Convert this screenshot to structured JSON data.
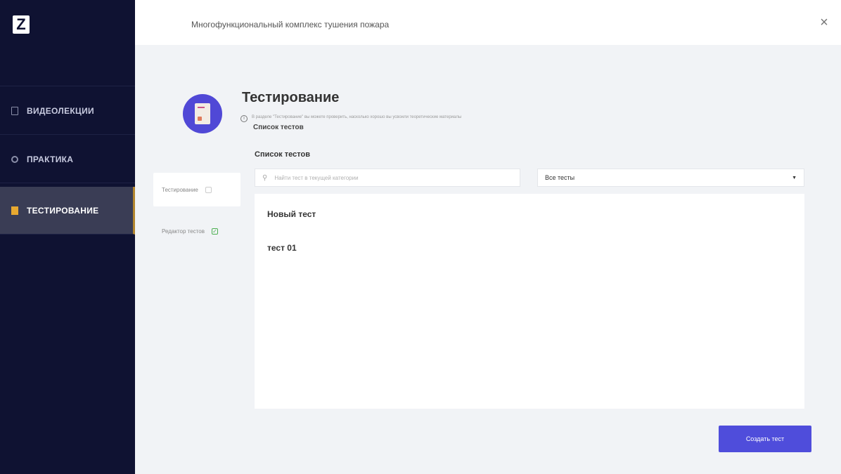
{
  "app": {
    "logo": "Z",
    "title": "Многофункциональный комплекс тушения пожара",
    "close": "×"
  },
  "sidebar": {
    "items": [
      {
        "label": "ВИДЕОЛЕКЦИИ",
        "icon": "book-icon",
        "active": false
      },
      {
        "label": "ПРАКТИКА",
        "icon": "gear-icon",
        "active": false
      },
      {
        "label": "ТЕСТИРОВАНИЕ",
        "icon": "checklist-icon",
        "active": true
      }
    ]
  },
  "header": {
    "title": "Тестирование",
    "description": "В разделе \"Тестирование\" вы можете проверить, насколько хорошо вы усвоили теоретические материалы",
    "breadcrumb": "Список тестов"
  },
  "subnav": {
    "items": [
      {
        "label": "Тестирование",
        "checked": false
      },
      {
        "label": "Редактор тестов",
        "checked": true
      }
    ]
  },
  "tests": {
    "section_title": "Список тестов",
    "search_placeholder": "Найти тест в текущей категории",
    "filter_selected": "Все тесты",
    "items": [
      "Новый тест",
      "тест 01"
    ]
  },
  "actions": {
    "create_label": "Создать тест"
  },
  "colors": {
    "sidebar_bg": "#0f1232",
    "accent": "#4f4ddb",
    "active_marker": "#e8a930"
  }
}
